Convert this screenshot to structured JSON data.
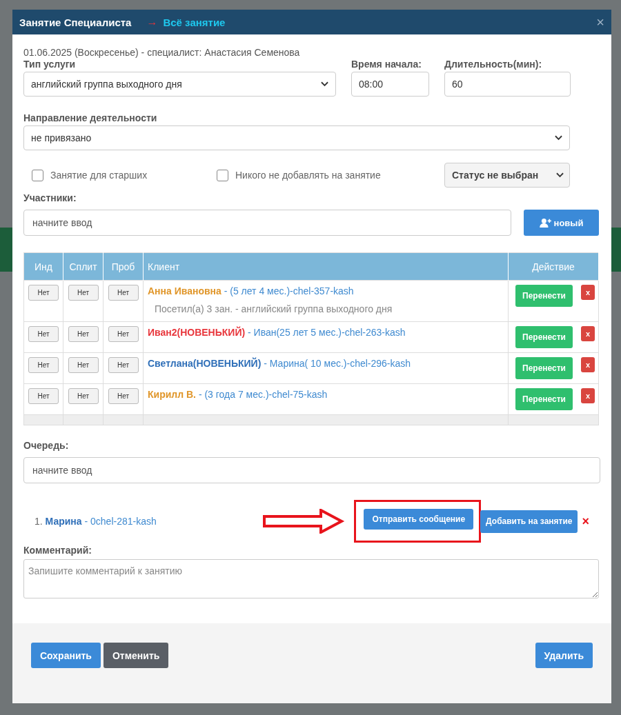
{
  "modal": {
    "title": "Занятие Специалиста",
    "link_arrow": "→",
    "link": "Всё занятие",
    "close": "×"
  },
  "subtitle": "01.06.2025 (Воскресенье) - специалист: Анастасия Семенова",
  "service_type": {
    "label": "Тип услуги",
    "value": "английский группа выходного дня"
  },
  "start_time": {
    "label": "Время начала:",
    "value": "08:00"
  },
  "duration": {
    "label": "Длительность(мин):",
    "value": "60"
  },
  "direction": {
    "label": "Направление деятельности",
    "value": "не привязано"
  },
  "checkboxes": [
    {
      "label": "Занятие для старших",
      "checked": false
    },
    {
      "label": "Никого не добавлять на занятие",
      "checked": false
    }
  ],
  "status_select": {
    "value": "Статус не выбран"
  },
  "participants": {
    "label": "Участники:",
    "placeholder": "начните ввод",
    "new_button": "новый"
  },
  "table": {
    "columns": [
      "Инд",
      "Сплит",
      "Проб",
      "Клиент",
      "Действие"
    ],
    "rows": [
      {
        "flags": [
          "Нет",
          "Нет",
          "Нет"
        ],
        "name": "Анна Ивановна",
        "color": "#e0962a",
        "details": " - (5 лет 4 мес.)-chel-357-kash",
        "note": "Посетил(а) 3 зан. - английский группа выходного дня",
        "move_button": "Перенести",
        "delete_button": "x"
      },
      {
        "flags": [
          "Нет",
          "Нет",
          "Нет"
        ],
        "name": "Иван2(НОВЕНЬКИЙ)",
        "color": "#e8363c",
        "details": " - Иван(25 лет 5 мес.)-chel-263-kash",
        "move_button": "Перенести",
        "delete_button": "x"
      },
      {
        "flags": [
          "Нет",
          "Нет",
          "Нет"
        ],
        "name": "Светлана(НОВЕНЬКИЙ)",
        "color": "#2f6fb8",
        "details": " - Марина( 10 мес.)-chel-296-kash",
        "move_button": "Перенести",
        "delete_button": "x"
      },
      {
        "flags": [
          "Нет",
          "Нет",
          "Нет"
        ],
        "name": "Кирилл В.",
        "color": "#e0962a",
        "details": " - (3 года 7 мес.)-chel-75-kash",
        "move_button": "Перенести",
        "delete_button": "x"
      }
    ]
  },
  "queue": {
    "label": "Очередь:",
    "placeholder": "начните ввод",
    "items": [
      {
        "number": "1.",
        "name": "Марина",
        "details": " - 0chel-281-kash",
        "send_button": "Отправить сообщение",
        "add_button": "Добавить на занятие",
        "remove": "×"
      }
    ]
  },
  "comment": {
    "label": "Комментарий:",
    "placeholder": "Запишите комментарий к занятию"
  },
  "footer": {
    "save": "Сохранить",
    "cancel": "Отменить",
    "delete": "Удалить"
  }
}
